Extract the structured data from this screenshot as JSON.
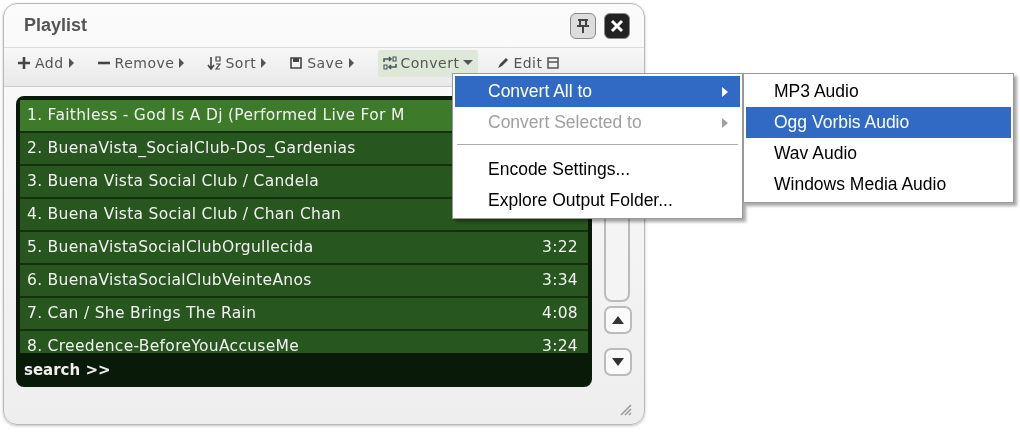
{
  "window": {
    "title": "Playlist"
  },
  "toolbar": [
    {
      "label": "Add",
      "active": false
    },
    {
      "label": "Remove",
      "active": false
    },
    {
      "label": "Sort",
      "active": false
    },
    {
      "label": "Save",
      "active": false
    },
    {
      "label": "Convert",
      "active": true
    },
    {
      "label": "Edit",
      "active": false
    }
  ],
  "tracks": [
    {
      "title": "1. Faithless - God Is A Dj (Performed Live For M"
    },
    {
      "title": "2. BuenaVista_SocialClub-Dos_Gardenias"
    },
    {
      "title": "3. Buena Vista Social Club / Candela"
    },
    {
      "title": "4. Buena Vista Social Club / Chan Chan"
    },
    {
      "title": "5. BuenaVistaSocialClubOrgullecida",
      "time": "3:22"
    },
    {
      "title": "6. BuenaVistaSocialClubVeinteAnos",
      "time": "3:34"
    },
    {
      "title": "7. Can / She Brings The Rain",
      "time": "4:08"
    },
    {
      "title": "8. Creedence-BeforeYouAccuseMe",
      "time": "3:24"
    }
  ],
  "search": {
    "label": "search >>"
  },
  "menu": [
    {
      "label": "Convert All to",
      "selected": true,
      "disabled": false,
      "submenu": true
    },
    {
      "label": "Convert Selected to",
      "selected": false,
      "disabled": true,
      "submenu": true
    },
    {
      "kind": "separator"
    },
    {
      "label": "Encode Settings...",
      "selected": false,
      "disabled": false,
      "submenu": false
    },
    {
      "label": "Explore Output Folder...",
      "selected": false,
      "disabled": false,
      "submenu": false
    }
  ],
  "submenu": [
    {
      "label": "MP3 Audio",
      "selected": false
    },
    {
      "label": "Ogg Vorbis Audio",
      "selected": true
    },
    {
      "label": "Wav Audio",
      "selected": false
    },
    {
      "label": "Windows Media Audio",
      "selected": false
    }
  ]
}
